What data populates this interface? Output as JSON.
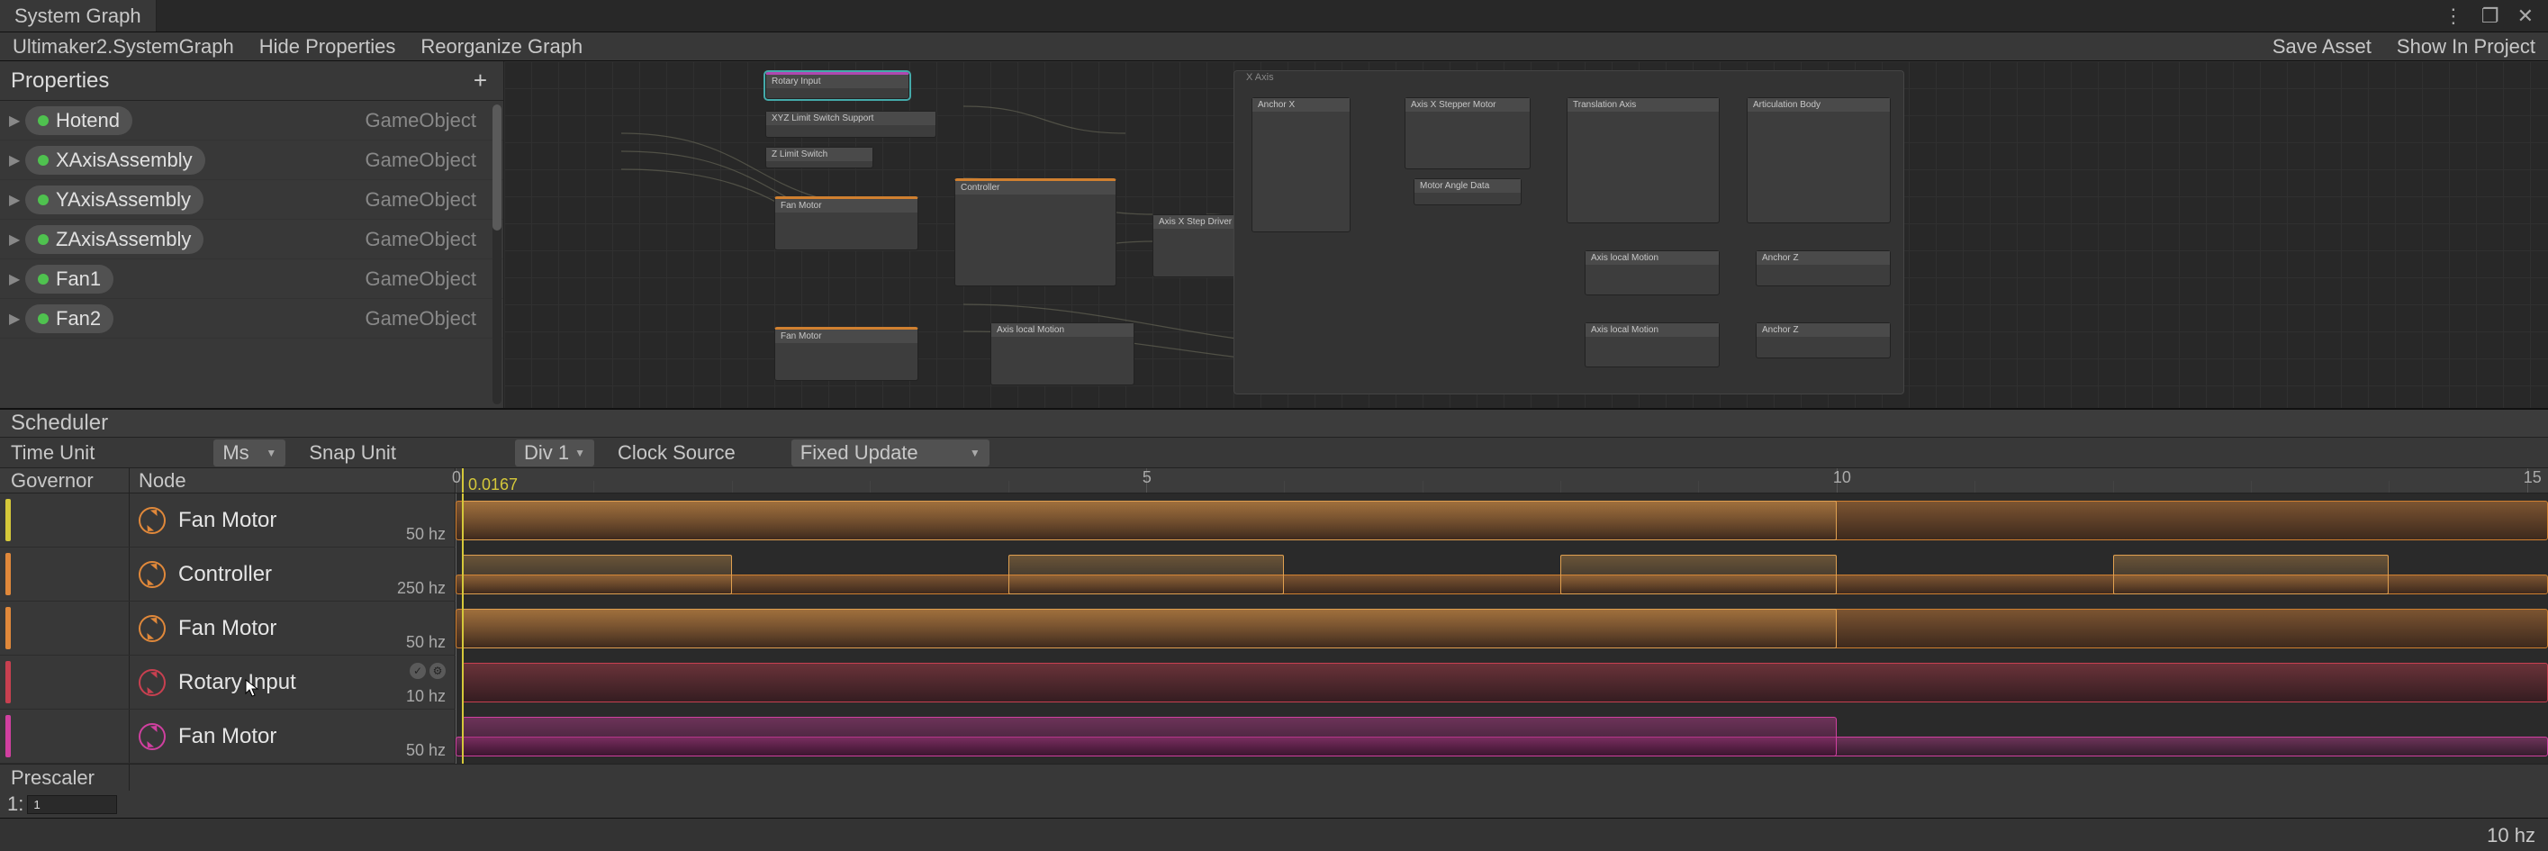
{
  "tab": {
    "title": "System Graph"
  },
  "window_controls": {
    "menu": "⋮",
    "restore": "❐",
    "close": "✕"
  },
  "toolbar": {
    "path": "Ultimaker2.SystemGraph",
    "hide_properties": "Hide Properties",
    "reorganize_graph": "Reorganize Graph",
    "save_asset": "Save Asset",
    "show_in_project": "Show In Project"
  },
  "properties": {
    "title": "Properties",
    "add_glyph": "+",
    "items": [
      {
        "name": "Hotend",
        "type": "GameObject"
      },
      {
        "name": "XAxisAssembly",
        "type": "GameObject"
      },
      {
        "name": "YAxisAssembly",
        "type": "GameObject"
      },
      {
        "name": "ZAxisAssembly",
        "type": "GameObject"
      },
      {
        "name": "Fan1",
        "type": "GameObject"
      },
      {
        "name": "Fan2",
        "type": "GameObject"
      }
    ]
  },
  "graph": {
    "group_label": "X Axis",
    "nodes": {
      "rotary_input": "Rotary Input",
      "limit_switch": "XYZ Limit Switch Support",
      "z_limit": "Z Limit Switch",
      "fan_motor": "Fan Motor",
      "controller": "Controller",
      "axis_local_motion": "Axis local Motion",
      "axis_x_stepper": "Axis X Stepper Motor",
      "motor_angle_data": "Motor Angle Data",
      "translation_axis": "Translation Axis",
      "anchor_x": "Anchor X",
      "anchor_z": "Anchor Z",
      "articulation_body": "Articulation Body",
      "step_driver": "Axis X Step Driver"
    }
  },
  "scheduler": {
    "title": "Scheduler",
    "time_unit_label": "Time Unit",
    "time_unit_value": "Ms",
    "snap_unit_label": "Snap Unit",
    "snap_unit_value": "Div 1",
    "clock_source_label": "Clock Source",
    "clock_source_value": "Fixed Update",
    "governor_label": "Governor",
    "node_label": "Node",
    "ruler_marks": [
      "0",
      "5",
      "10",
      "15"
    ],
    "marker_value": "0.0167",
    "tracks": [
      {
        "name": "Fan Motor",
        "hz": "50 hz",
        "color": "orange"
      },
      {
        "name": "Controller",
        "hz": "250 hz",
        "color": "orange"
      },
      {
        "name": "Fan Motor",
        "hz": "50 hz",
        "color": "orange"
      },
      {
        "name": "Rotary Input",
        "hz": "10 hz",
        "color": "red",
        "selected": true
      },
      {
        "name": "Fan Motor",
        "hz": "50 hz",
        "color": "pink"
      }
    ],
    "prescaler_label": "Prescaler",
    "prescaler_index": "1:",
    "prescaler_value": "1"
  },
  "status": {
    "hz": "10 hz"
  }
}
